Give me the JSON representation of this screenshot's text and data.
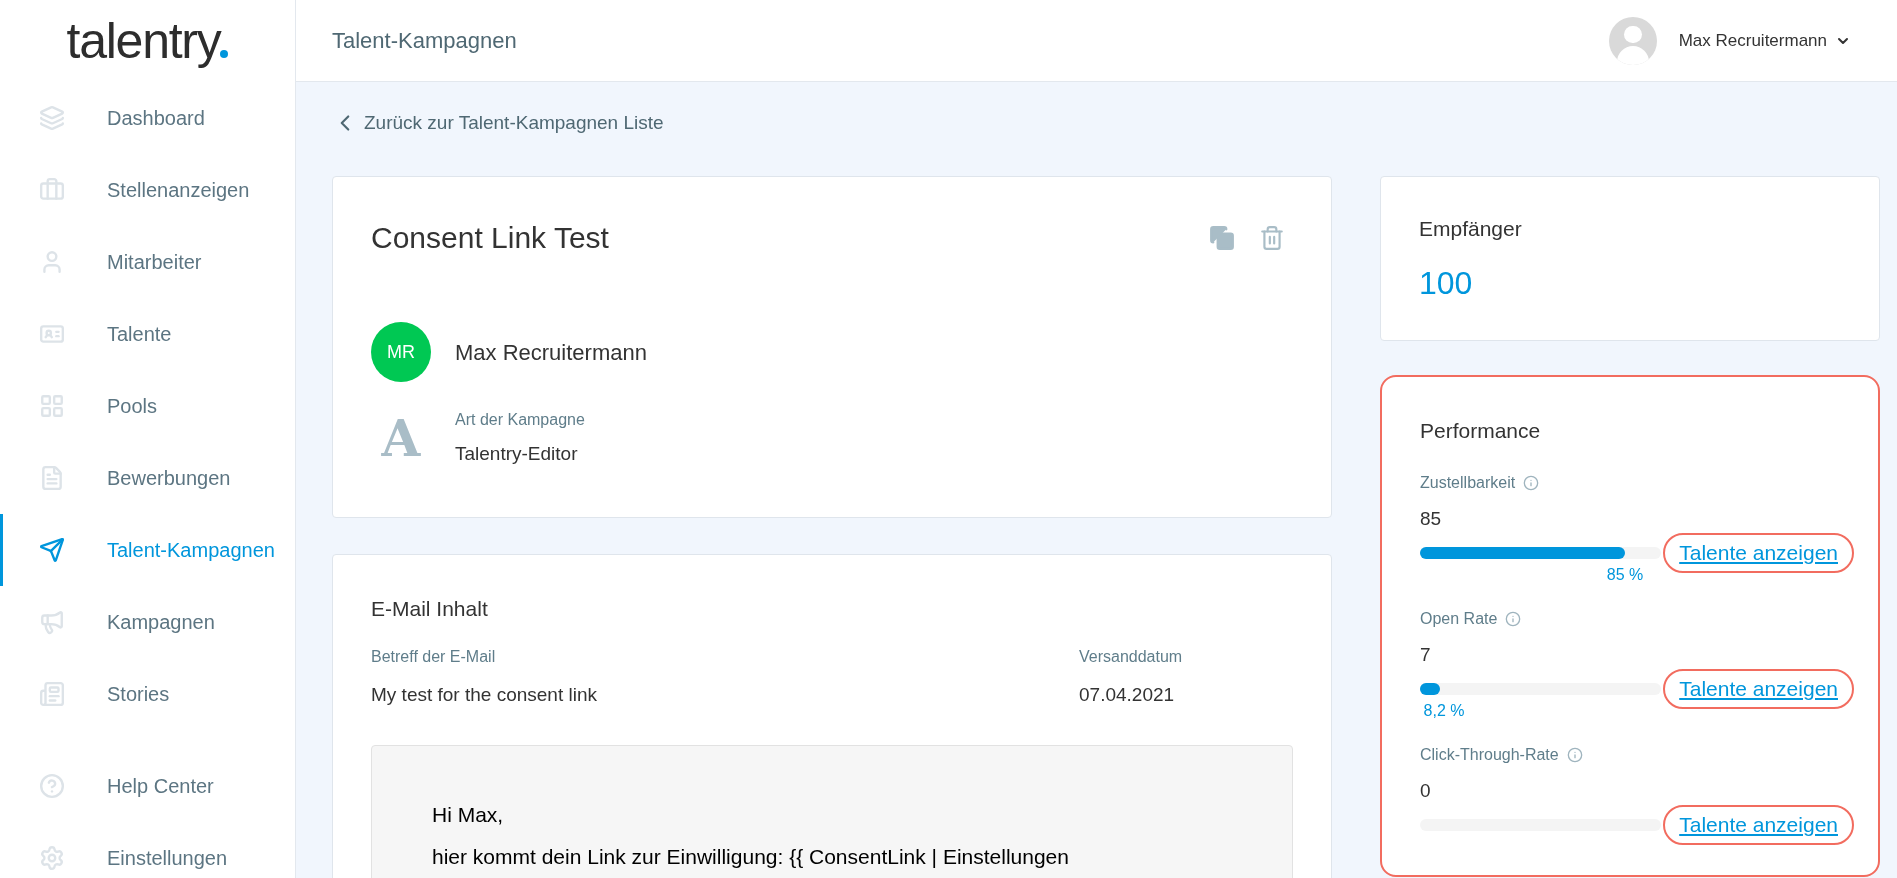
{
  "logo": "talentry",
  "sidebar": {
    "items": [
      {
        "kind": "layers",
        "label": "Dashboard",
        "selected": false
      },
      {
        "kind": "briefcase",
        "label": "Stellenanzeigen",
        "selected": false
      },
      {
        "kind": "user",
        "label": "Mitarbeiter",
        "selected": false
      },
      {
        "kind": "idcard",
        "label": "Talente",
        "selected": false
      },
      {
        "kind": "grid",
        "label": "Pools",
        "selected": false
      },
      {
        "kind": "file",
        "label": "Bewerbungen",
        "selected": false
      },
      {
        "kind": "plane",
        "label": "Talent-Kampagnen",
        "selected": true
      },
      {
        "kind": "megaphone",
        "label": "Kampagnen",
        "selected": false
      },
      {
        "kind": "newspaper",
        "label": "Stories",
        "selected": false
      }
    ],
    "bottom_items": [
      {
        "kind": "help",
        "label": "Help Center",
        "selected": false
      },
      {
        "kind": "gear",
        "label": "Einstellungen",
        "selected": false
      }
    ]
  },
  "header": {
    "title": "Talent-Kampagnen",
    "user": "Max Recruitermann"
  },
  "back_link": "Zurück zur Talent-Kampagnen Liste",
  "campaign": {
    "title": "Consent Link Test",
    "owner_initials": "MR",
    "owner": "Max Recruitermann",
    "type_icon": "A",
    "type_label": "Art der Kampagne",
    "type_value": "Talentry-Editor"
  },
  "email": {
    "heading": "E-Mail Inhalt",
    "subject_label": "Betreff der E-Mail",
    "subject": "My test for the consent link",
    "date_label": "Versanddatum",
    "date": "07.04.2021",
    "body": [
      "Hi Max,",
      "hier kommt dein Link zur Einwilligung: {{ ConsentLink | Einstellungen"
    ]
  },
  "recipients": {
    "label": "Empfänger",
    "value": "100"
  },
  "performance": {
    "title": "Performance",
    "metrics": [
      {
        "label": "Zustellbarkeit",
        "value": "85",
        "level": 0.85,
        "percent": "85 %",
        "link": "Talente anzeigen"
      },
      {
        "label": "Open Rate",
        "value": "7",
        "level": 0.082,
        "percent": "8,2 %",
        "link": "Talente anzeigen"
      },
      {
        "label": "Click-Through-Rate",
        "value": "0",
        "link": "Talente anzeigen"
      }
    ]
  }
}
